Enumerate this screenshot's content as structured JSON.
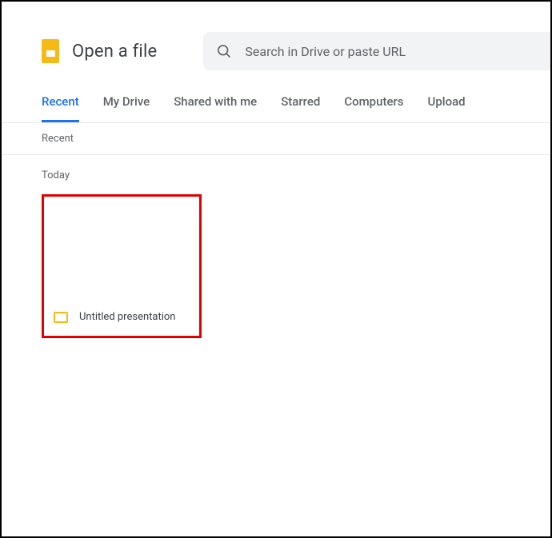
{
  "header": {
    "title": "Open a file"
  },
  "search": {
    "placeholder": "Search in Drive or paste URL"
  },
  "tabs": [
    {
      "label": "Recent",
      "active": true
    },
    {
      "label": "My Drive",
      "active": false
    },
    {
      "label": "Shared with me",
      "active": false
    },
    {
      "label": "Starred",
      "active": false
    },
    {
      "label": "Computers",
      "active": false
    },
    {
      "label": "Upload",
      "active": false
    }
  ],
  "section": {
    "label": "Recent"
  },
  "groups": [
    {
      "label": "Today",
      "files": [
        {
          "name": "Untitled presentation",
          "type": "slides"
        }
      ]
    }
  ]
}
